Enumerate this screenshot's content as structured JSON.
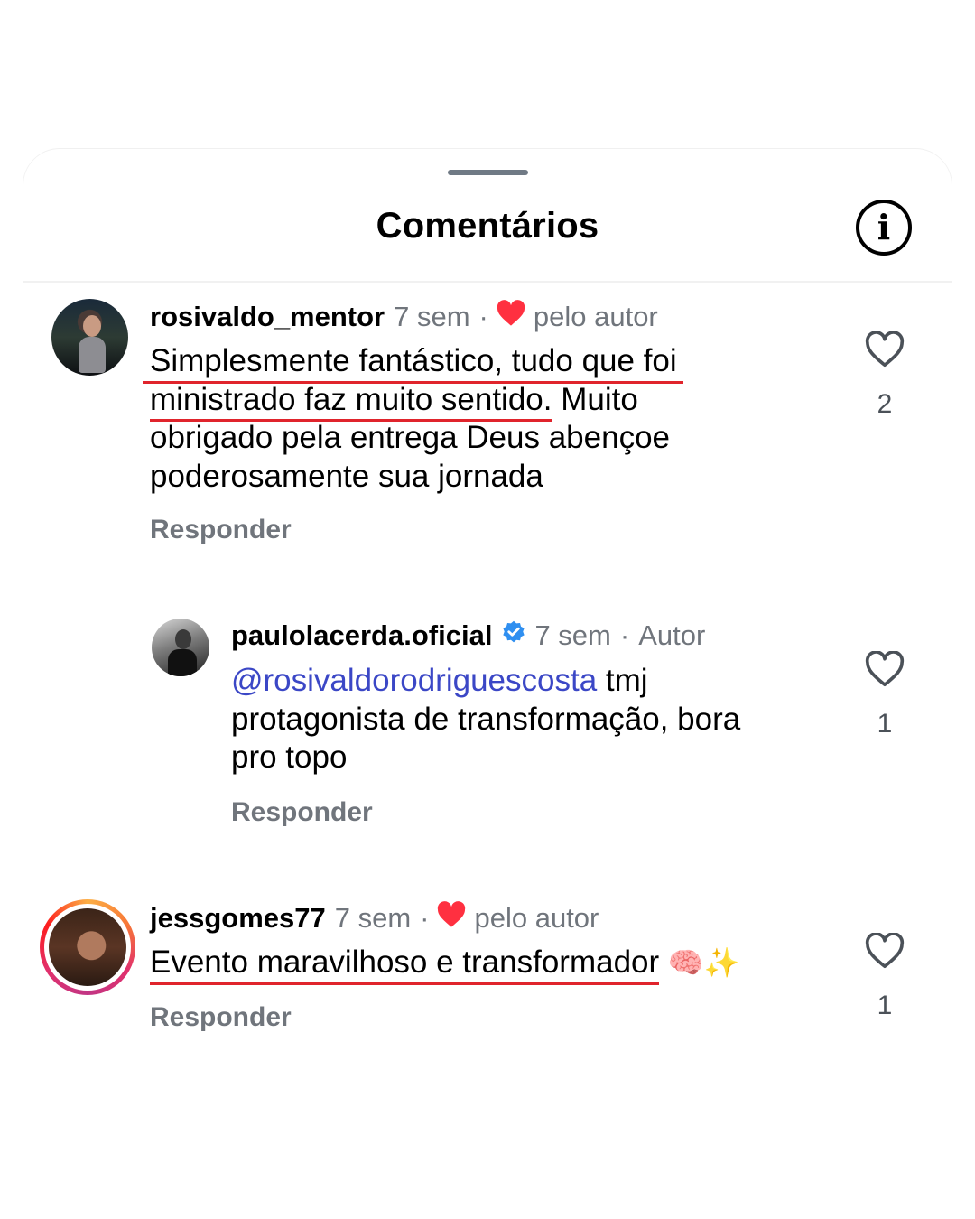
{
  "header": {
    "title": "Comentários"
  },
  "comments": [
    {
      "username": "rosivaldo_mentor",
      "time": "7 sem",
      "separator": "·",
      "badge": "pelo autor",
      "lines": [
        "Simplesmente fantástico, tudo que foi",
        "ministrado faz muito sentido.",
        " Muito",
        "obrigado pela entrega Deus abençoe",
        "poderosamente sua jornada"
      ],
      "reply_label": "Responder",
      "like_count": "2"
    },
    {
      "username": "paulolacerda.oficial",
      "time": "7 sem",
      "separator": "·",
      "badge": "Autor",
      "mention": "@rosivaldorodriguescosta",
      "lines": [
        " tmj",
        "protagonista de transformação, bora",
        "pro topo"
      ],
      "reply_label": "Responder",
      "like_count": "1"
    },
    {
      "username": "jessgomes77",
      "time": "7 sem",
      "separator": "·",
      "badge": "pelo autor",
      "lines": [
        "Evento maravilhoso e transformador"
      ],
      "emoji": "🧠✨",
      "reply_label": "Responder",
      "like_count": "1"
    }
  ],
  "colors": {
    "accent_red": "#e0242c",
    "heart_red": "#ff3040",
    "mention_blue": "#3b47c6",
    "verified_blue": "#2f8ff0",
    "muted_gray": "#70757c"
  },
  "icons": {
    "info": "info-icon",
    "like": "heart-outline-icon",
    "liked_by_author": "heart-filled-icon",
    "verified": "verified-badge-icon"
  }
}
